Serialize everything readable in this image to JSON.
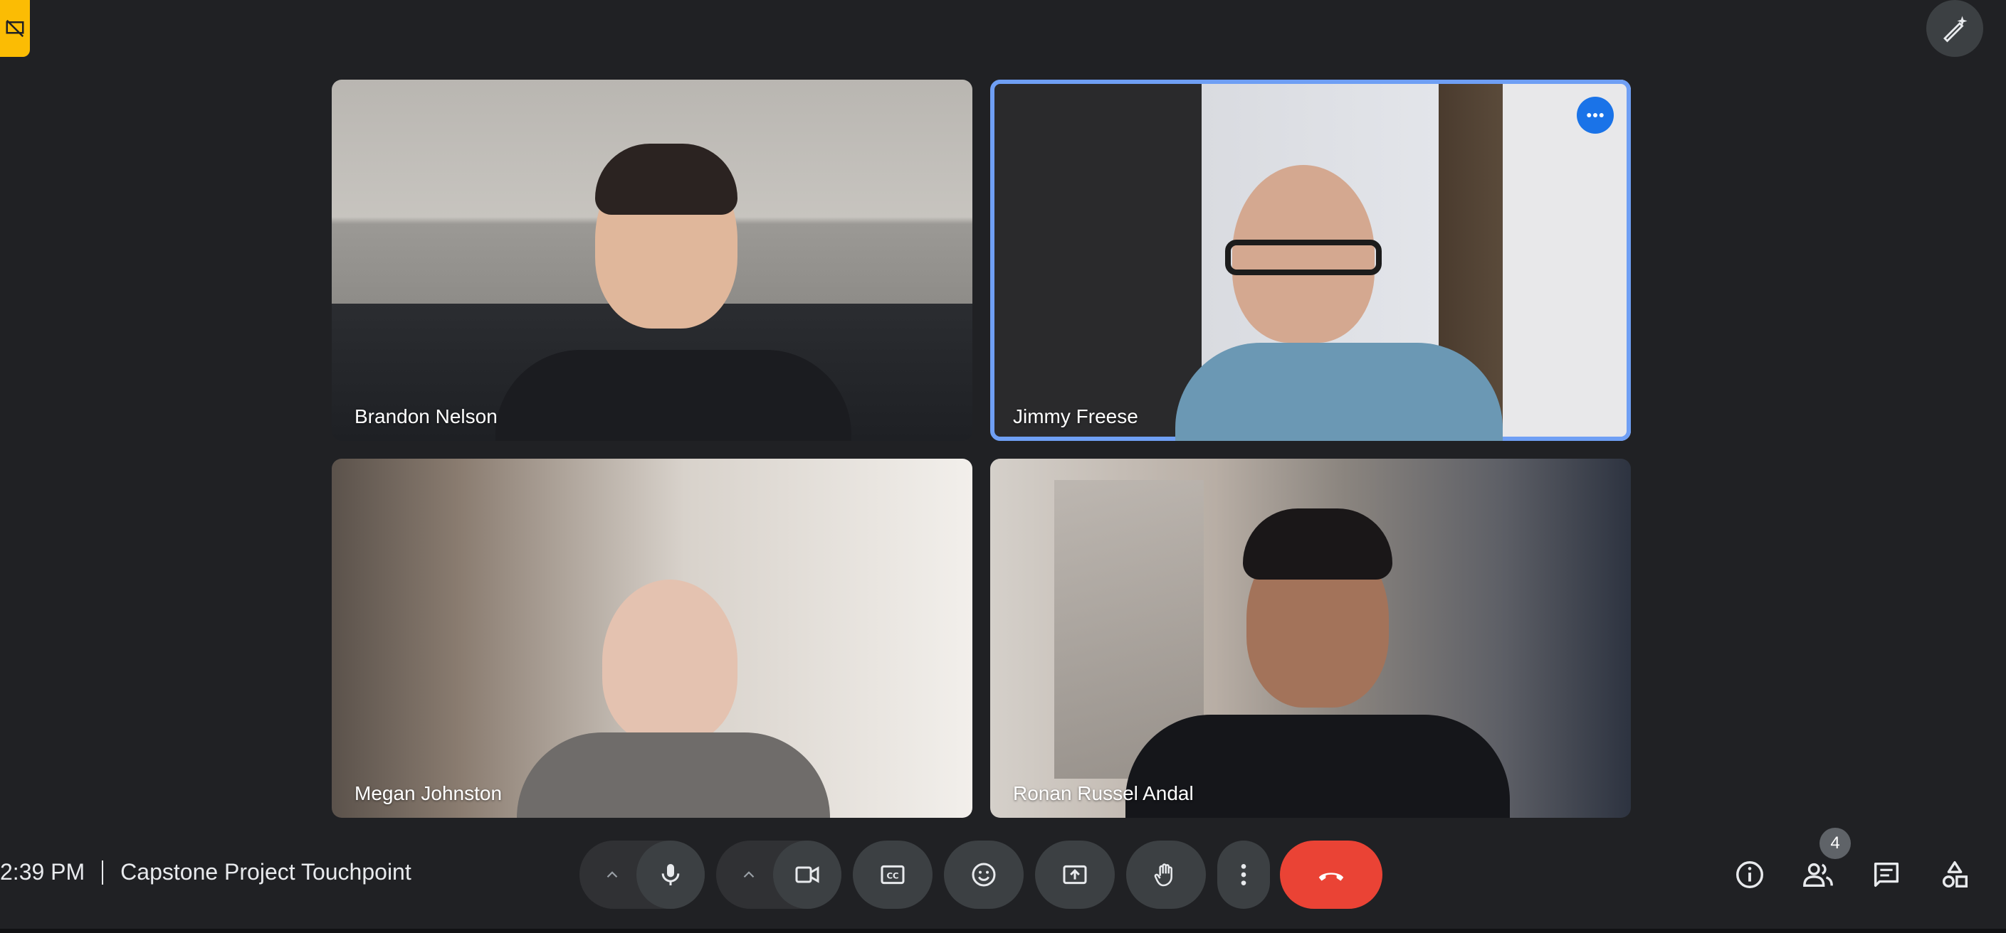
{
  "meeting": {
    "time": "2:39 PM",
    "title": "Capstone Project Touchpoint"
  },
  "participants": [
    {
      "name": "Brandon Nelson"
    },
    {
      "name": "Jimmy Freese",
      "highlighted": true
    },
    {
      "name": "Megan Johnston"
    },
    {
      "name": "Ronan Russel Andal"
    }
  ],
  "controls": {
    "microphone": "mic-icon",
    "camera": "videocam-icon",
    "captions": "closed-caption-icon",
    "reactions": "emoji-icon",
    "present": "present-screen-icon",
    "raise_hand": "hand-icon",
    "more": "more-vert-icon",
    "leave": "call-end-icon"
  },
  "side_controls": {
    "info": "info-icon",
    "people": "people-icon",
    "people_count": "4",
    "chat": "chat-icon",
    "activities": "activities-icon"
  },
  "colors": {
    "background": "#202124",
    "control": "#3c4043",
    "leave": "#ea4335",
    "active_speaker": "#6f9ff4",
    "menu_button": "#1a73e8",
    "alert_badge": "#fbbc04"
  }
}
